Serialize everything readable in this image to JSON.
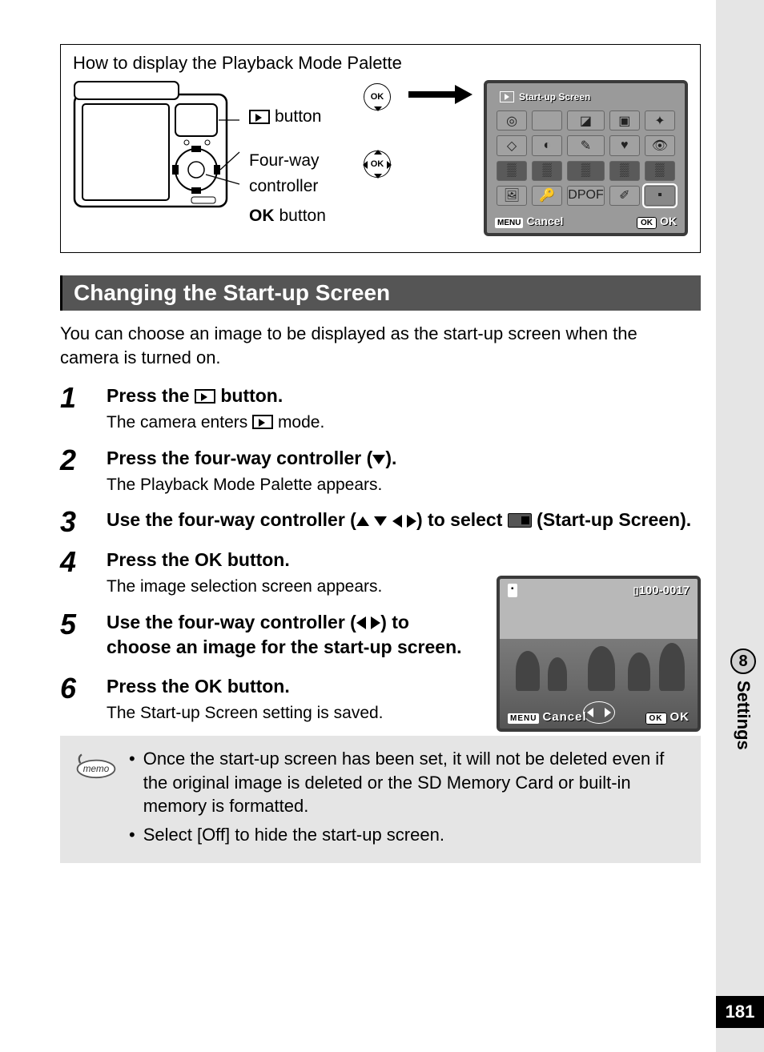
{
  "page_number": "181",
  "chapter_number": "8",
  "chapter_label": "Settings",
  "box": {
    "title": "How to display the Playback Mode Palette",
    "label_playback": " button",
    "label_fourway": "Four-way controller",
    "label_ok": " button",
    "ok_prefix": "OK"
  },
  "lcd1": {
    "title": "Start-up Screen",
    "footer_left": "Cancel",
    "footer_left_badge": "MENU",
    "footer_right": "OK",
    "footer_right_badge": "OK"
  },
  "heading": "Changing the Start-up Screen",
  "intro": "You can choose an image to be displayed as the start-up screen when the camera is turned on.",
  "steps": {
    "s1": {
      "num": "1",
      "title_a": "Press the ",
      "title_b": " button.",
      "desc_a": "The camera enters ",
      "desc_b": " mode."
    },
    "s2": {
      "num": "2",
      "title": "Press the four-way controller (",
      "title_suffix": ").",
      "desc": "The Playback Mode Palette appears."
    },
    "s3": {
      "num": "3",
      "title_a": "Use the four-way controller (",
      "title_b": ") to select ",
      "title_c": " (Start-up Screen)."
    },
    "s4": {
      "num": "4",
      "title_a": "Press the ",
      "title_ok": "OK",
      "title_b": " button.",
      "desc": "The image selection screen appears."
    },
    "s5": {
      "num": "5",
      "title_a": "Use the four-way controller (",
      "title_b": ") to choose an image for the start-up screen."
    },
    "s6": {
      "num": "6",
      "title_a": "Press the ",
      "title_ok": "OK",
      "title_b": " button.",
      "desc": "The Start-up Screen setting is saved."
    }
  },
  "lcd2": {
    "counter": "100-0017",
    "cancel_badge": "MENU",
    "cancel": "Cancel",
    "ok_badge": "OK",
    "ok": "OK"
  },
  "memo": {
    "label": "memo",
    "m1": "Once the start-up screen has been set, it will not be deleted even if the original image is deleted or the SD Memory Card or built-in memory is formatted.",
    "m2": "Select [Off] to hide the start-up screen."
  }
}
